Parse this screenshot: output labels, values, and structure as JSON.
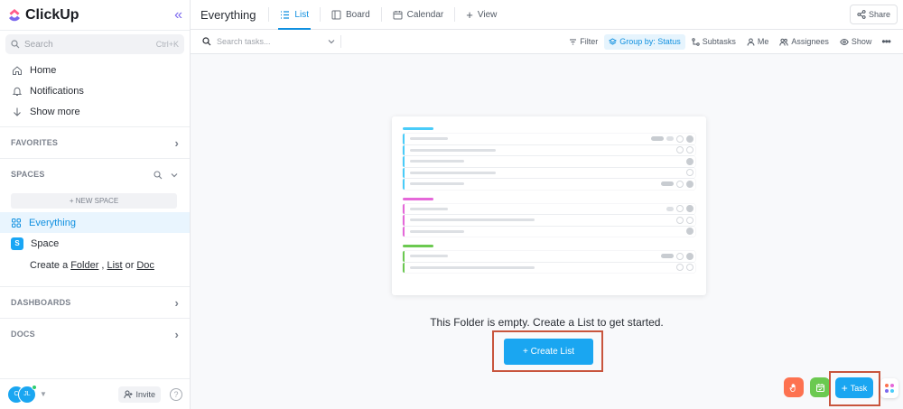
{
  "app": {
    "name": "ClickUp"
  },
  "sidebar": {
    "search_placeholder": "Search",
    "search_shortcut": "Ctrl+K",
    "nav": [
      {
        "label": "Home",
        "icon": "home-icon"
      },
      {
        "label": "Notifications",
        "icon": "bell-icon"
      },
      {
        "label": "Show more",
        "icon": "arrow-down-icon"
      }
    ],
    "favorites_label": "FAVORITES",
    "spaces_label": "SPACES",
    "new_space_label": "+ NEW SPACE",
    "spaces": [
      {
        "label": "Everything",
        "icon": "grid-icon"
      },
      {
        "label": "Space",
        "badge": "S"
      }
    ],
    "create": {
      "prefix": "Create a",
      "folder": "Folder",
      "list": "List",
      "or": "or",
      "doc": "Doc"
    },
    "dashboards_label": "DASHBOARDS",
    "docs_label": "DOCS",
    "avatars": [
      "C",
      "JL"
    ],
    "invite_label": "Invite",
    "help_label": "?"
  },
  "header": {
    "title": "Everything",
    "tabs": [
      {
        "label": "List",
        "icon": "list-icon",
        "active": true
      },
      {
        "label": "Board",
        "icon": "board-icon",
        "active": false
      },
      {
        "label": "Calendar",
        "icon": "calendar-icon",
        "active": false
      }
    ],
    "add_view_label": "View",
    "share_label": "Share"
  },
  "toolbar": {
    "search_placeholder": "Search tasks...",
    "filter_label": "Filter",
    "groupby_label": "Group by: Status",
    "subtasks_label": "Subtasks",
    "me_label": "Me",
    "assignees_label": "Assignees",
    "show_label": "Show"
  },
  "main": {
    "empty_message": "This Folder is empty. Create a List to get started.",
    "create_list_label": "+ Create List"
  },
  "floating": {
    "task_label": "Task"
  },
  "colors": {
    "accent": "#1aa6f1",
    "brand_purple": "#7b68ee",
    "highlight_box": "#c8553d",
    "group_blue": "#49ccf9",
    "group_pink": "#e568d9",
    "group_green": "#6bc950"
  }
}
